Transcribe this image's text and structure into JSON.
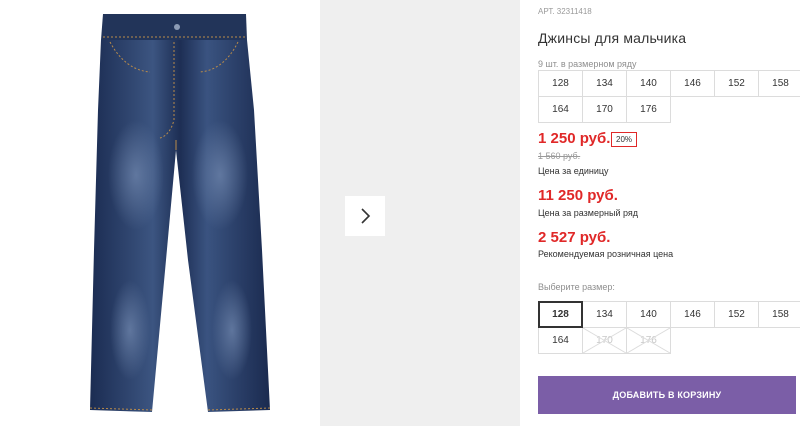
{
  "product": {
    "article": "АРТ. 32311418",
    "title": "Джинсы для мальчика"
  },
  "size_range": {
    "note": "9 шт. в размерном ряду",
    "sizes": [
      "128",
      "134",
      "140",
      "146",
      "152",
      "158",
      "164",
      "170",
      "176"
    ]
  },
  "prices": {
    "unit_price": "1 250 руб.",
    "discount": "20%",
    "old_price": "1 560 руб.",
    "unit_label": "Цена за единицу",
    "range_price": "11 250 руб.",
    "range_label": "Цена за размерный ряд",
    "retail_price": "2 527 руб.",
    "retail_label": "Рекомендуемая розничная цена"
  },
  "size_select": {
    "label": "Выберите размер:",
    "sizes": [
      "128",
      "134",
      "140",
      "146",
      "152",
      "158",
      "164",
      "170",
      "176"
    ],
    "selected": "128",
    "unavailable": [
      "170",
      "176"
    ]
  },
  "cart": {
    "button_label": "ДОБАВИТЬ В КОРЗИНУ"
  },
  "colors": {
    "price_red": "#e02828",
    "button_purple": "#7b5ea7"
  },
  "icons": {
    "next": "chevron-right-icon"
  }
}
